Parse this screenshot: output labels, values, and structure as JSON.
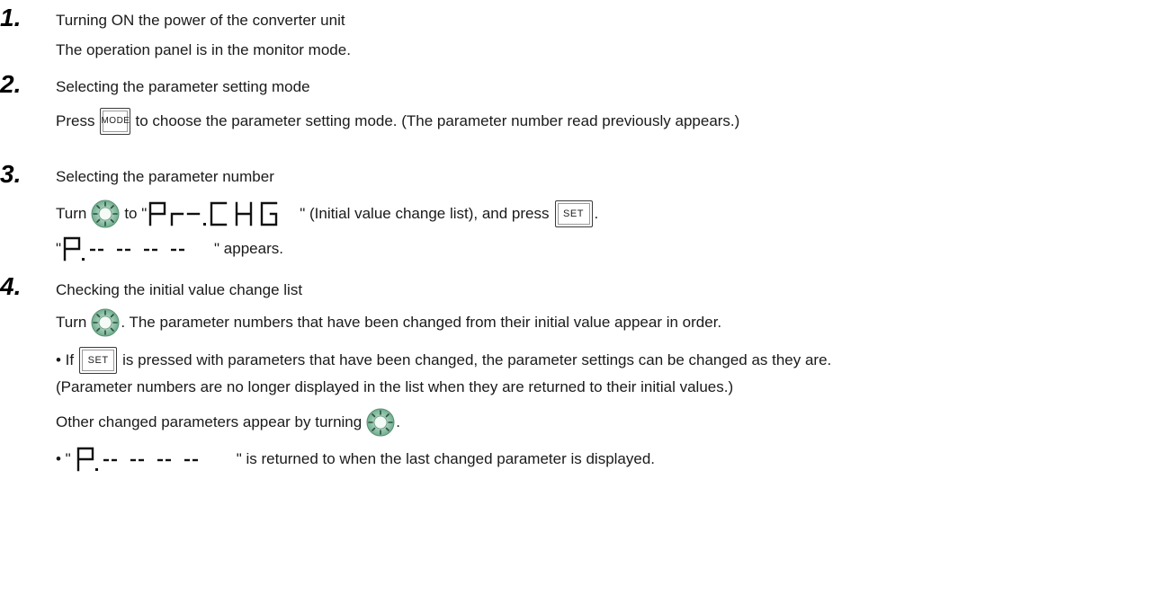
{
  "steps": [
    {
      "number": "1.",
      "title": "Turning ON the power of the converter unit",
      "lines": [
        "The operation panel is in the monitor mode."
      ]
    },
    {
      "number": "2.",
      "title": "Selecting the parameter setting mode",
      "press": "Press",
      "after_mode": "to choose the parameter setting mode. (The parameter number read previously appears.)"
    },
    {
      "number": "3.",
      "title": "Selecting the parameter number",
      "turn": "Turn",
      "to_quote": "to \"",
      "after_display": "\" (Initial value change list), and press",
      "period": ".",
      "quote_open": "\"",
      "appears": "\" appears."
    },
    {
      "number": "4.",
      "title": "Checking the initial value change list",
      "turn": "Turn",
      "after_dial": ". The parameter numbers that have been changed from their initial value appear in order.",
      "bullet_if": "• If",
      "bullet_rest": "is pressed with parameters that have been changed, the parameter settings can be changed as they are.",
      "note": "(Parameter numbers are no longer displayed in the list when they are returned to their initial values.)",
      "other": "Other changed parameters appear by turning",
      "other_end": ".",
      "last_open": "• \"",
      "last_rest": "\" is returned to when the last changed parameter is displayed."
    }
  ],
  "keys": {
    "mode": "MODE",
    "set": "SET"
  },
  "displays": {
    "chg": "Pr-.CHG",
    "list": "P.-- -- -- --"
  },
  "icons": {
    "dial": "setting-dial-icon"
  }
}
